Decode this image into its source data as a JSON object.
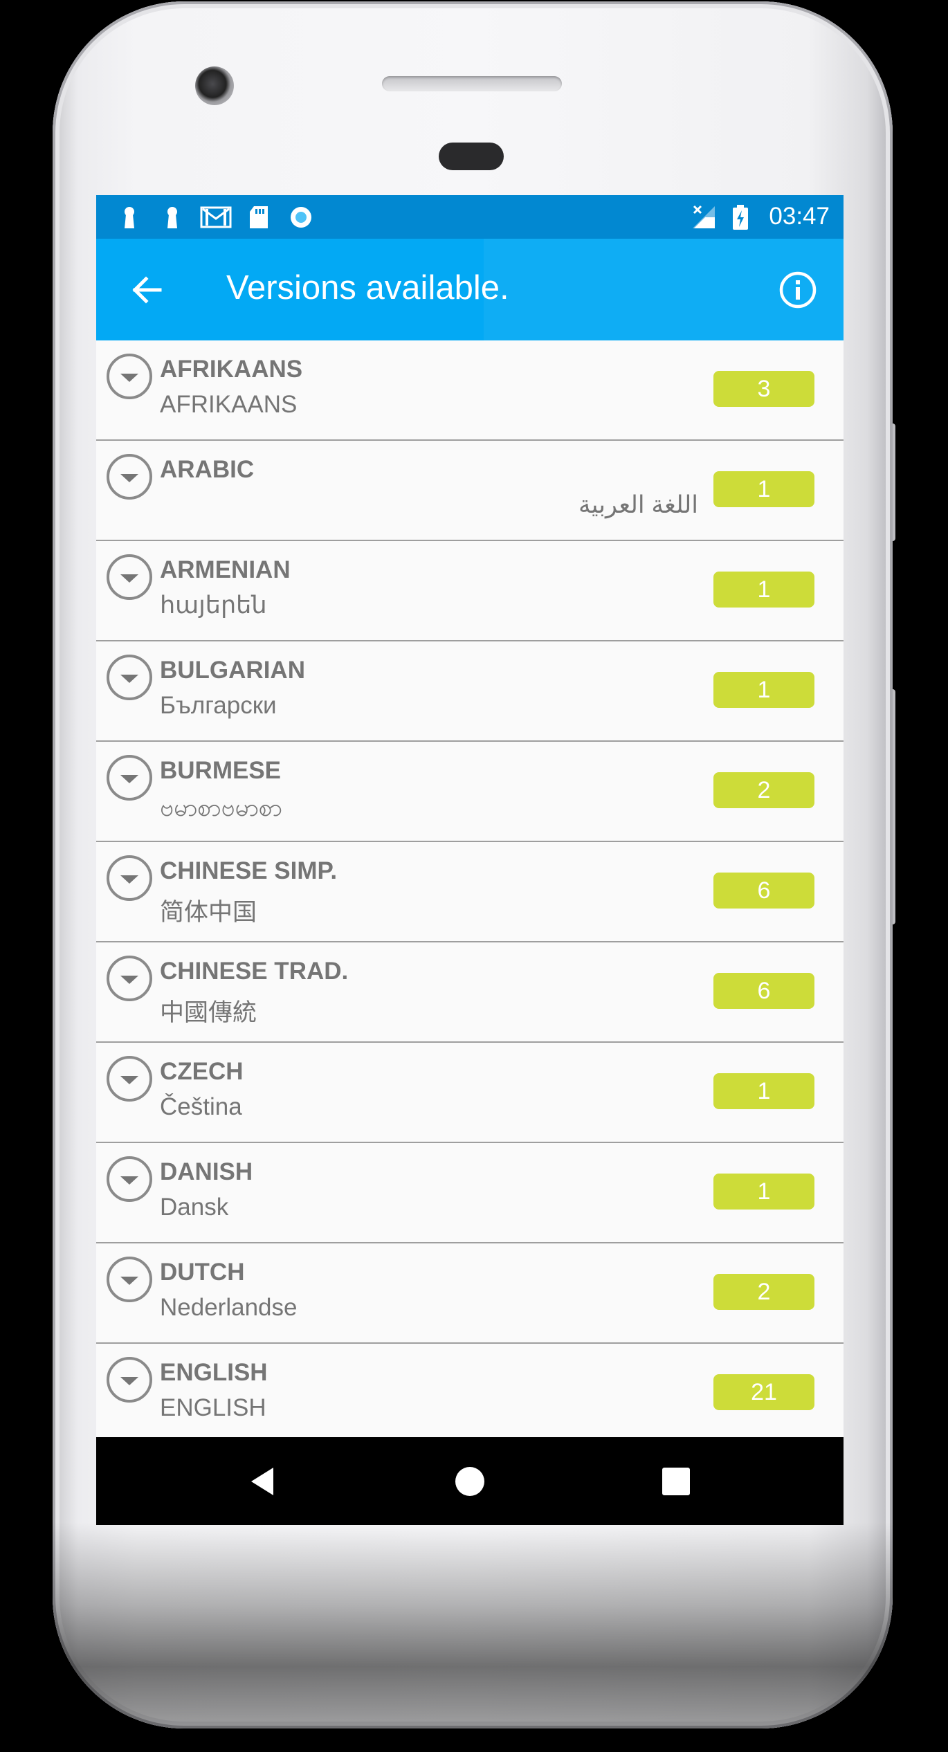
{
  "status_bar": {
    "time": "03:47",
    "icons": [
      "keyhole-icon",
      "keyhole-icon",
      "gmail-icon",
      "sd-card-icon",
      "circle-record-icon",
      "signal-off-icon",
      "battery-charging-icon"
    ]
  },
  "app_bar": {
    "title": "Versions available.",
    "back_icon": "arrow-back-icon",
    "info_icon": "info-icon"
  },
  "languages": [
    {
      "name": "AFRIKAANS",
      "native": "AFRIKAANS",
      "count": "3",
      "rtl": false
    },
    {
      "name": "ARABIC",
      "native": "اللغة العربية",
      "count": "1",
      "rtl": true
    },
    {
      "name": "ARMENIAN",
      "native": "հայերեն",
      "count": "1",
      "rtl": false
    },
    {
      "name": "BULGARIAN",
      "native": "Български",
      "count": "1",
      "rtl": false
    },
    {
      "name": "BURMESE",
      "native": "ဗမာစာဗမာစာ",
      "count": "2",
      "rtl": false
    },
    {
      "name": "CHINESE SIMP.",
      "native": "简体中国",
      "count": "6",
      "rtl": false
    },
    {
      "name": "CHINESE TRAD.",
      "native": "中國傳統",
      "count": "6",
      "rtl": false
    },
    {
      "name": "CZECH",
      "native": "Čeština",
      "count": "1",
      "rtl": false
    },
    {
      "name": "DANISH",
      "native": "Dansk",
      "count": "1",
      "rtl": false
    },
    {
      "name": "DUTCH",
      "native": "Nederlandse",
      "count": "2",
      "rtl": false
    },
    {
      "name": "ENGLISH",
      "native": "ENGLISH",
      "count": "21",
      "rtl": false
    }
  ],
  "colors": {
    "status_bar": "#0288d1",
    "app_bar": "#03a9f4",
    "badge": "#cddc39",
    "text": "#757575"
  },
  "nav_bar": {
    "icons": [
      "nav-back-icon",
      "nav-home-icon",
      "nav-recents-icon"
    ]
  }
}
